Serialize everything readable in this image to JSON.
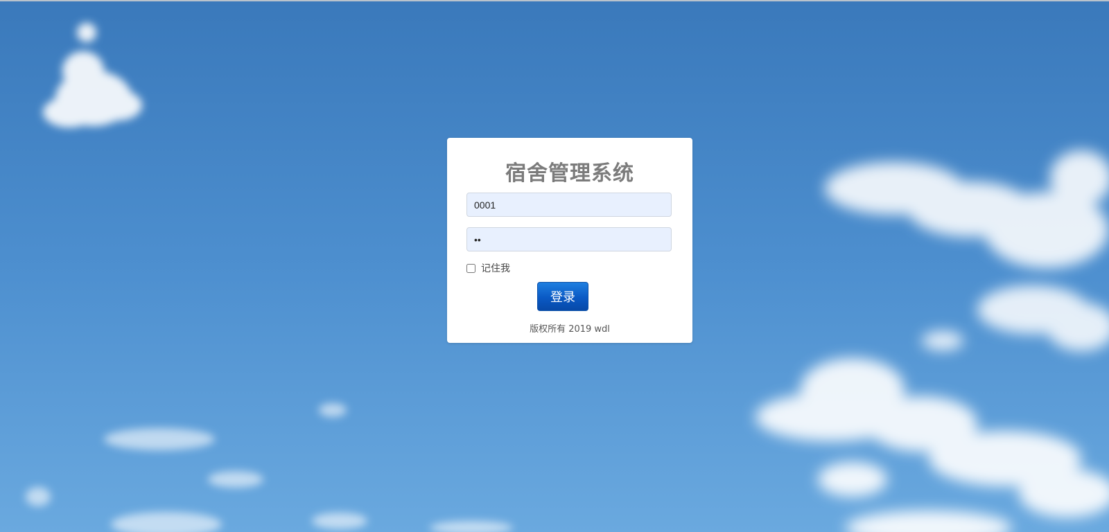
{
  "login": {
    "title": "宿舍管理系统",
    "username_value": "0001",
    "password_value": "ab",
    "remember_label": "记住我",
    "remember_checked": false,
    "submit_label": "登录",
    "copyright": "版权所有 2019 wdl"
  },
  "colors": {
    "sky": "#4b8ccd",
    "card": "#ffffff",
    "title": "#7b7b7b",
    "input_bg": "#e8f0fe",
    "button": "#0a59c4"
  }
}
